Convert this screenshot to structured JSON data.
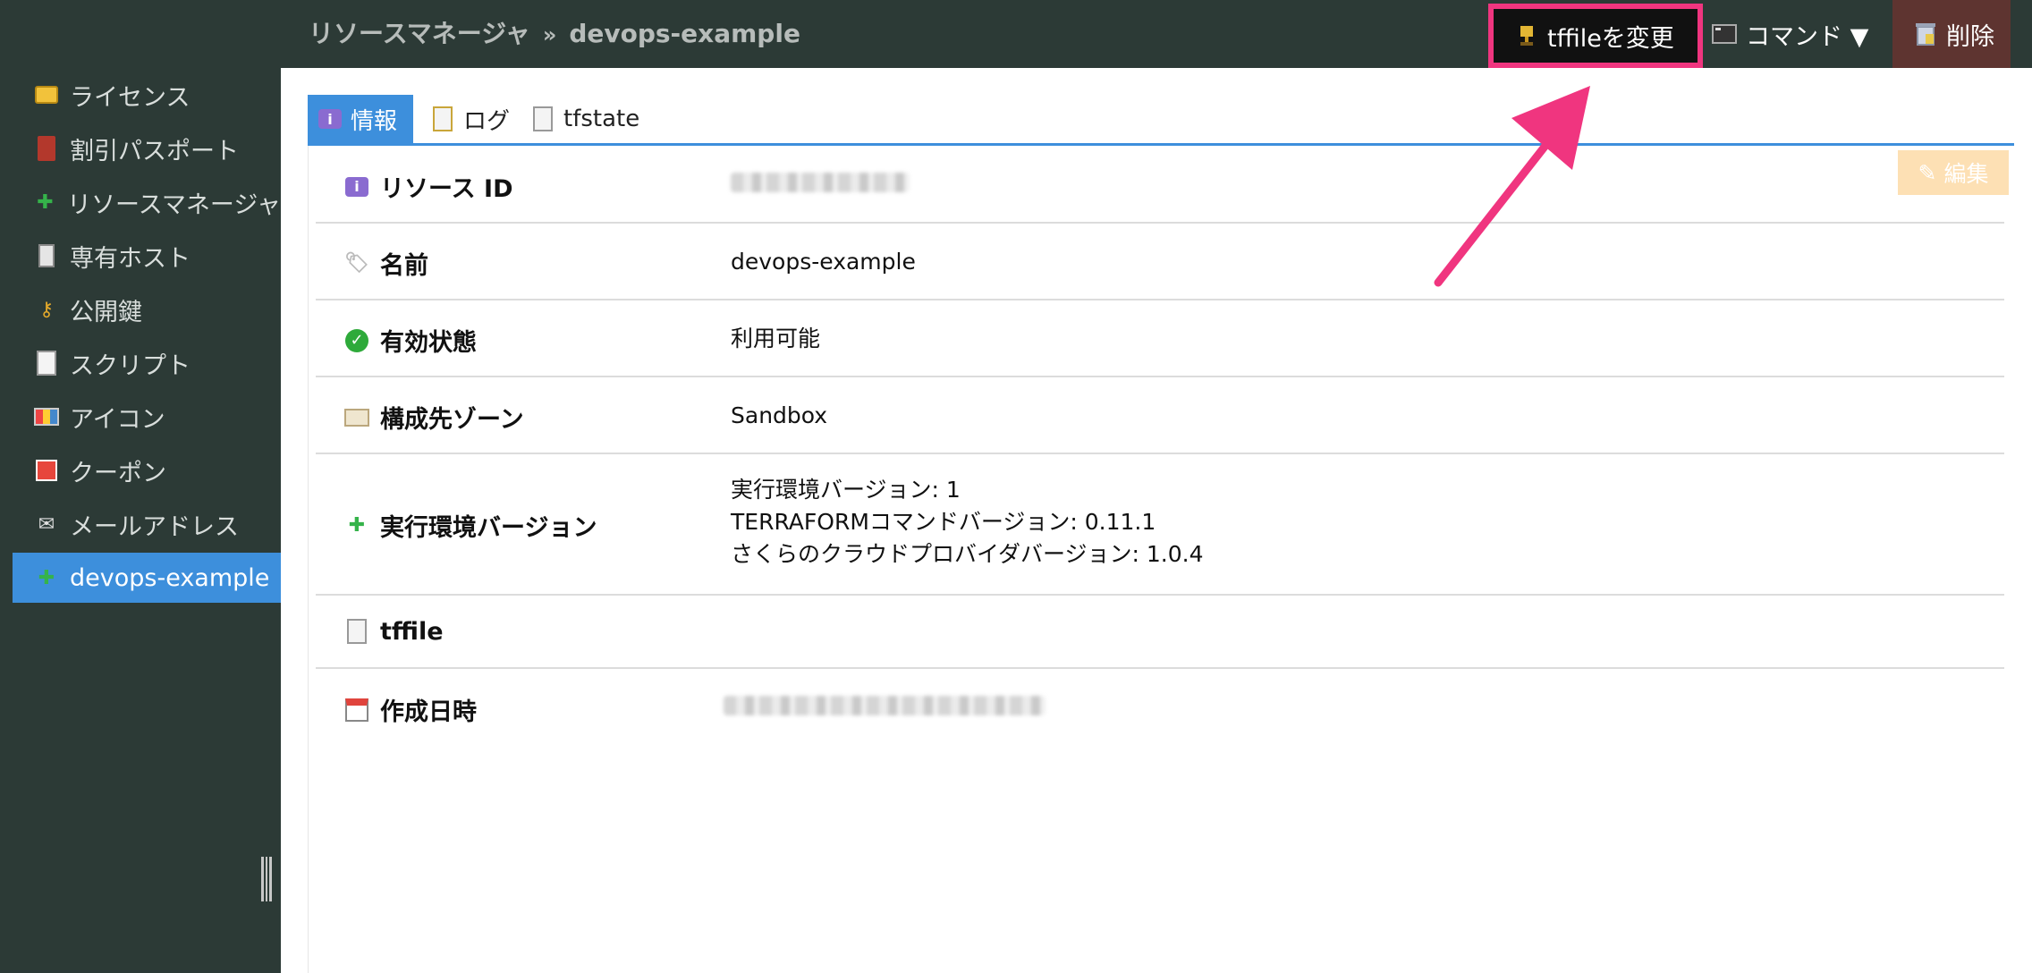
{
  "breadcrumb": {
    "parent": "リソースマネージャ",
    "separator": "»",
    "current": "devops-example"
  },
  "toolbar": {
    "tffile_label": "tffileを変更",
    "command_label": "コマンド ▼",
    "delete_label": "削除"
  },
  "sidebar": {
    "items": [
      {
        "label": "ライセンス",
        "icon": "license-icon"
      },
      {
        "label": "割引パスポート",
        "icon": "passport-icon"
      },
      {
        "label": "リソースマネージャ",
        "icon": "puzzle-icon"
      },
      {
        "label": "専有ホスト",
        "icon": "server-icon"
      },
      {
        "label": "公開鍵",
        "icon": "key-icon"
      },
      {
        "label": "スクリプト",
        "icon": "document-icon"
      },
      {
        "label": "アイコン",
        "icon": "icons-icon"
      },
      {
        "label": "クーポン",
        "icon": "gift-icon"
      },
      {
        "label": "メールアドレス",
        "icon": "mail-icon"
      },
      {
        "label": "devops-example",
        "icon": "puzzle-icon",
        "active": true
      }
    ]
  },
  "tabs": [
    {
      "label": "情報",
      "icon": "info-icon",
      "active": true
    },
    {
      "label": "ログ",
      "icon": "log-icon"
    },
    {
      "label": "tfstate",
      "icon": "document-icon"
    }
  ],
  "edit_label": "編集",
  "details": {
    "resource_id": {
      "label": "リソース ID",
      "value": ""
    },
    "name": {
      "label": "名前",
      "value": "devops-example"
    },
    "availability": {
      "label": "有効状態",
      "value": "利用可能"
    },
    "zone": {
      "label": "構成先ゾーン",
      "value": "Sandbox"
    },
    "runtime": {
      "label": "実行環境バージョン",
      "lines": [
        "実行環境バージョン: 1",
        "TERRAFORMコマンドバージョン: 0.11.1",
        "さくらのクラウドプロバイダバージョン: 1.0.4"
      ]
    },
    "tffile": {
      "label": "tffile",
      "value": ""
    },
    "created_at": {
      "label": "作成日時",
      "value": ""
    }
  },
  "colors": {
    "accent": "#3d8fdc",
    "highlight": "#f0357f",
    "sidebar_bg": "#2c3a36",
    "delete_bg": "#5e3430"
  }
}
